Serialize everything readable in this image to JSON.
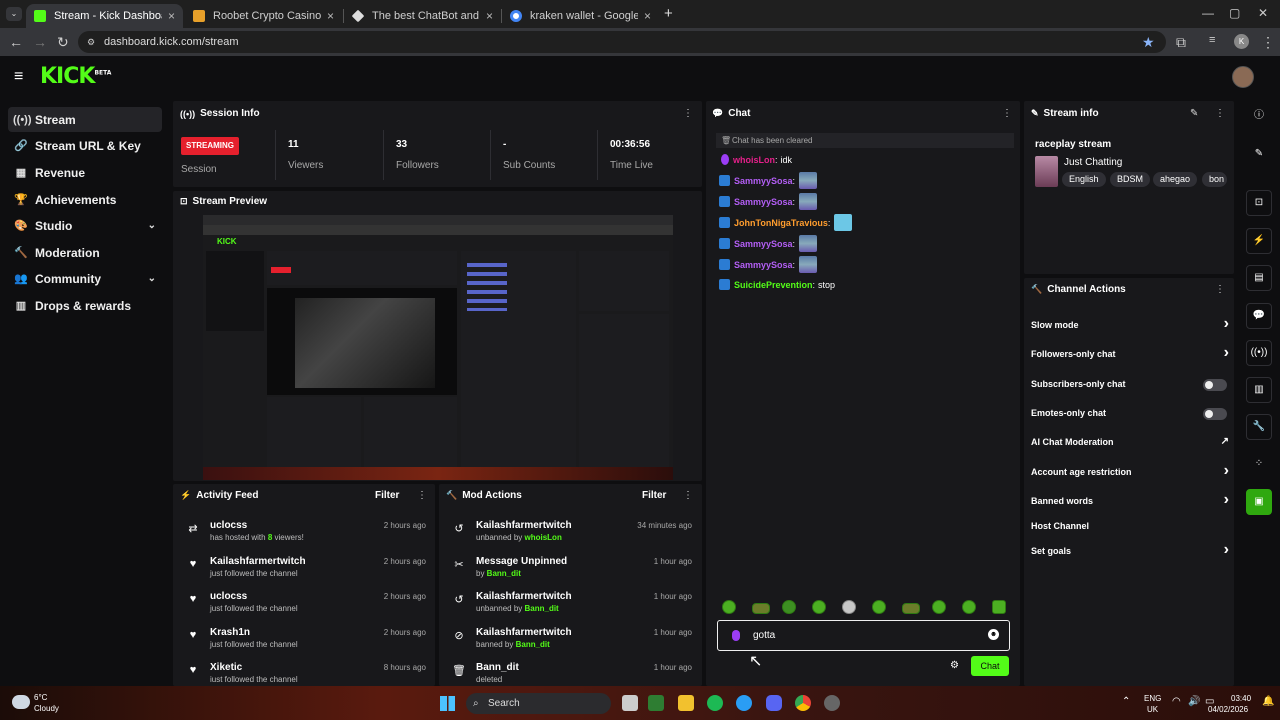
{
  "browser": {
    "tabs": [
      {
        "title": "Stream - Kick Dashboard",
        "color": "#53fc18"
      },
      {
        "title": "Roobet Crypto Casino | Best Bit",
        "color": "#e7a02a"
      },
      {
        "title": "The best ChatBot and Widg",
        "color": "#dddddd"
      },
      {
        "title": "kraken wallet - Google Search",
        "color": "#4285f4"
      }
    ],
    "new_tab": "+",
    "close_glyph": "×",
    "url": "dashboard.kick.com/stream",
    "min": "—",
    "max": "▢",
    "close": "✕",
    "back": "←",
    "forward": "→",
    "reload": "↻",
    "star": "★",
    "ext": "⧉",
    "profile_initial": "K"
  },
  "header": {
    "logo": "KICK",
    "beta": "BETA",
    "menu_glyph": "≡"
  },
  "sidebar": {
    "items": [
      {
        "label": "Stream",
        "icon": "((•))",
        "icon_name": "broadcast-icon",
        "chevron": false
      },
      {
        "label": "Stream URL & Key",
        "icon": "🔗",
        "icon_name": "link-icon",
        "chevron": false
      },
      {
        "label": "Revenue",
        "icon": "▦",
        "icon_name": "revenue-icon",
        "chevron": false
      },
      {
        "label": "Achievements",
        "icon": "🏆",
        "icon_name": "trophy-icon",
        "chevron": false
      },
      {
        "label": "Studio",
        "icon": "🎨",
        "icon_name": "palette-icon",
        "chevron": true
      },
      {
        "label": "Moderation",
        "icon": "🔨",
        "icon_name": "hammer-icon",
        "chevron": false
      },
      {
        "label": "Community",
        "icon": "👥",
        "icon_name": "people-icon",
        "chevron": true
      },
      {
        "label": "Drops & rewards",
        "icon": "▥",
        "icon_name": "gift-icon",
        "chevron": false
      }
    ],
    "chevron_glyph": "⌄"
  },
  "session": {
    "title": "Session Info",
    "badge": "STREAMING",
    "session_label": "Session",
    "stats": [
      {
        "value": "11",
        "label": "Viewers"
      },
      {
        "value": "33",
        "label": "Followers"
      },
      {
        "value": "-",
        "label": "Sub Counts"
      },
      {
        "value": "00:36:56",
        "label": "Time Live"
      }
    ]
  },
  "preview": {
    "title": "Stream Preview"
  },
  "activity": {
    "title": "Activity Feed",
    "filter": "Filter",
    "items": [
      {
        "name": "uclocss",
        "pre": "has hosted with ",
        "hl": "8",
        "post": " viewers!",
        "time": "2 hours ago",
        "icon": "⇄"
      },
      {
        "name": "Kailashfarmertwitch",
        "pre": "just followed the channel",
        "hl": "",
        "post": "",
        "time": "2 hours ago",
        "icon": "♥"
      },
      {
        "name": "uclocss",
        "pre": "just followed the channel",
        "hl": "",
        "post": "",
        "time": "2 hours ago",
        "icon": "♥"
      },
      {
        "name": "Krash1n",
        "pre": "just followed the channel",
        "hl": "",
        "post": "",
        "time": "2 hours ago",
        "icon": "♥"
      },
      {
        "name": "Xiketic",
        "pre": "just followed the channel",
        "hl": "",
        "post": "",
        "time": "8 hours ago",
        "icon": "♥"
      }
    ]
  },
  "mod": {
    "title": "Mod Actions",
    "filter": "Filter",
    "items": [
      {
        "name": "Kailashfarmertwitch",
        "pre": "unbanned by ",
        "hl": "whoisLon",
        "time": "34 minutes ago",
        "icon": "↺"
      },
      {
        "name": "Message Unpinned",
        "pre": "by ",
        "hl": "Bann_dit",
        "time": "1 hour ago",
        "icon": "✂"
      },
      {
        "name": "Kailashfarmertwitch",
        "pre": "unbanned by ",
        "hl": "Bann_dit",
        "time": "1 hour ago",
        "icon": "↺"
      },
      {
        "name": "Kailashfarmertwitch",
        "pre": "banned by ",
        "hl": "Bann_dit",
        "time": "1 hour ago",
        "icon": "⊘"
      },
      {
        "name": "Bann_dit",
        "pre": "deleted",
        "hl": "",
        "time": "1 hour ago",
        "icon": "🗑"
      }
    ]
  },
  "chat": {
    "title": "Chat",
    "cleared": "Chat has been cleared",
    "messages": [
      {
        "user": "whoisLon",
        "color": "#e5208a",
        "badge": "mic",
        "text": "idk",
        "emote": ""
      },
      {
        "user": "SammyySosa",
        "color": "#b35ef5",
        "badge": "mod",
        "text": "",
        "emote": "e1"
      },
      {
        "user": "SammyySosa",
        "color": "#b35ef5",
        "badge": "mod",
        "text": "",
        "emote": "e1"
      },
      {
        "user": "JohnTonNigaTravious",
        "color": "#ff9d2e",
        "badge": "mod",
        "text": "",
        "emote": "e2"
      },
      {
        "user": "SammyySosa",
        "color": "#b35ef5",
        "badge": "mod",
        "text": "",
        "emote": "e1"
      },
      {
        "user": "SammyySosa",
        "color": "#b35ef5",
        "badge": "mod",
        "text": "",
        "emote": "e1"
      },
      {
        "user": "SuicidePrevention",
        "color": "#53fc18",
        "badge": "mod",
        "text": "stop",
        "emote": ""
      }
    ],
    "input_value": "gotta",
    "send_label": "Chat"
  },
  "stream_info": {
    "title": "Stream info",
    "stream_title": "raceplay stream",
    "category": "Just Chatting",
    "tags": [
      "English",
      "BDSM",
      "ahegao",
      "bon"
    ]
  },
  "channel_actions": {
    "title": "Channel Actions",
    "rows": [
      {
        "label": "Slow mode",
        "control": "chevron"
      },
      {
        "label": "Followers-only chat",
        "control": "chevron"
      },
      {
        "label": "Subscribers-only chat",
        "control": "toggle"
      },
      {
        "label": "Emotes-only chat",
        "control": "toggle"
      },
      {
        "label": "AI Chat Moderation",
        "control": "external"
      },
      {
        "label": "Account age restriction",
        "control": "chevron"
      },
      {
        "label": "Banned words",
        "control": "chevron"
      },
      {
        "label": "Host Channel",
        "control": "none"
      },
      {
        "label": "Set goals",
        "control": "chevron"
      }
    ]
  },
  "taskbar": {
    "weather_temp": "6°C",
    "weather_desc": "Cloudy",
    "search": "Search",
    "lang": "ENG",
    "region": "UK",
    "time": "03:40",
    "date": "04/02/2026",
    "tray_arrow": "⌃"
  }
}
